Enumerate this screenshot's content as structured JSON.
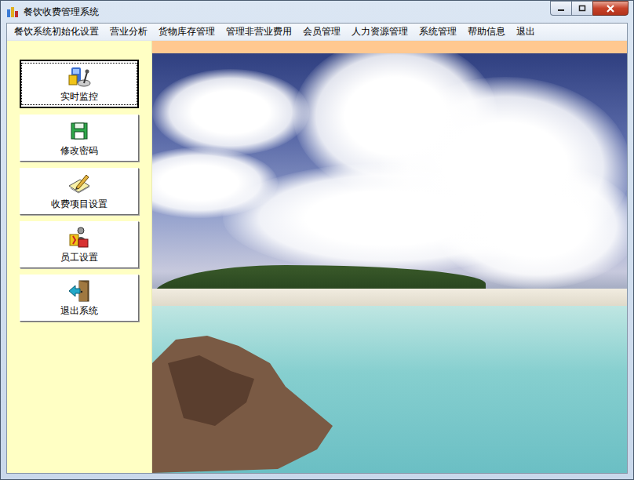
{
  "window": {
    "title": "餐饮收费管理系统"
  },
  "menu": [
    {
      "label": "餐饮系统初始化设置"
    },
    {
      "label": "营业分析"
    },
    {
      "label": "货物库存管理"
    },
    {
      "label": "管理非营业费用"
    },
    {
      "label": "会员管理"
    },
    {
      "label": "人力资源管理"
    },
    {
      "label": "系统管理"
    },
    {
      "label": "帮助信息"
    },
    {
      "label": "退出"
    }
  ],
  "sidebar": {
    "items": [
      {
        "label": "实时监控",
        "selected": true,
        "kind": "monitor"
      },
      {
        "label": "修改密码",
        "selected": false,
        "kind": "disk"
      },
      {
        "label": "收费项目设置",
        "selected": false,
        "kind": "edit"
      },
      {
        "label": "员工设置",
        "selected": false,
        "kind": "staff"
      },
      {
        "label": "退出系统",
        "selected": false,
        "kind": "exit"
      }
    ]
  }
}
